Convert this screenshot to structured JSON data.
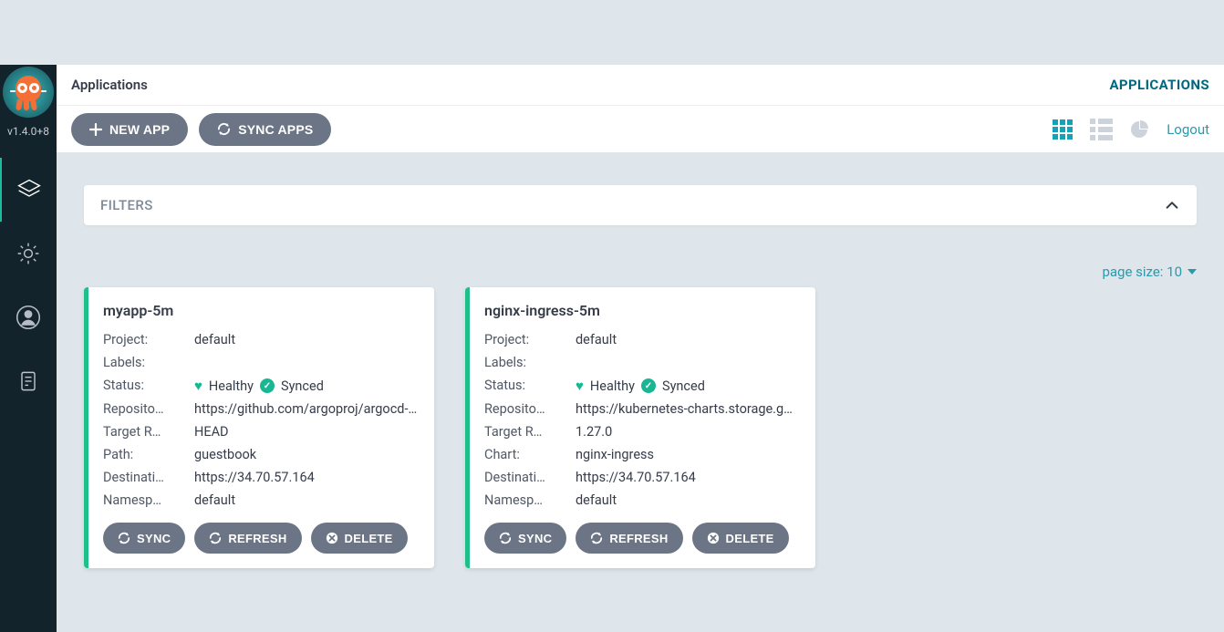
{
  "sidebar": {
    "version": "v1.4.0+8"
  },
  "header": {
    "title": "Applications",
    "rightLink": "APPLICATIONS"
  },
  "toolbar": {
    "newApp": "NEW APP",
    "syncApps": "SYNC APPS",
    "logout": "Logout"
  },
  "filters": {
    "label": "FILTERS"
  },
  "paging": {
    "label": "page size: 10"
  },
  "labels": {
    "project": "Project:",
    "labels": "Labels:",
    "status": "Status:",
    "repository": "Reposito…",
    "targetRevision": "Target R…",
    "path": "Path:",
    "chart": "Chart:",
    "destination": "Destinati…",
    "namespace": "Namesp…",
    "healthy": "Healthy",
    "synced": "Synced"
  },
  "actions": {
    "sync": "SYNC",
    "refresh": "REFRESH",
    "delete": "DELETE"
  },
  "apps": [
    {
      "name": "myapp-5m",
      "project": "default",
      "labelsVal": "",
      "repository": "https://github.com/argoproj/argocd-exa…",
      "targetRevision": "HEAD",
      "extraKey": "path",
      "extraVal": "guestbook",
      "destination": "https://34.70.57.164",
      "namespace": "default"
    },
    {
      "name": "nginx-ingress-5m",
      "project": "default",
      "labelsVal": "",
      "repository": "https://kubernetes-charts.storage.googl…",
      "targetRevision": "1.27.0",
      "extraKey": "chart",
      "extraVal": "nginx-ingress",
      "destination": "https://34.70.57.164",
      "namespace": "default"
    }
  ]
}
